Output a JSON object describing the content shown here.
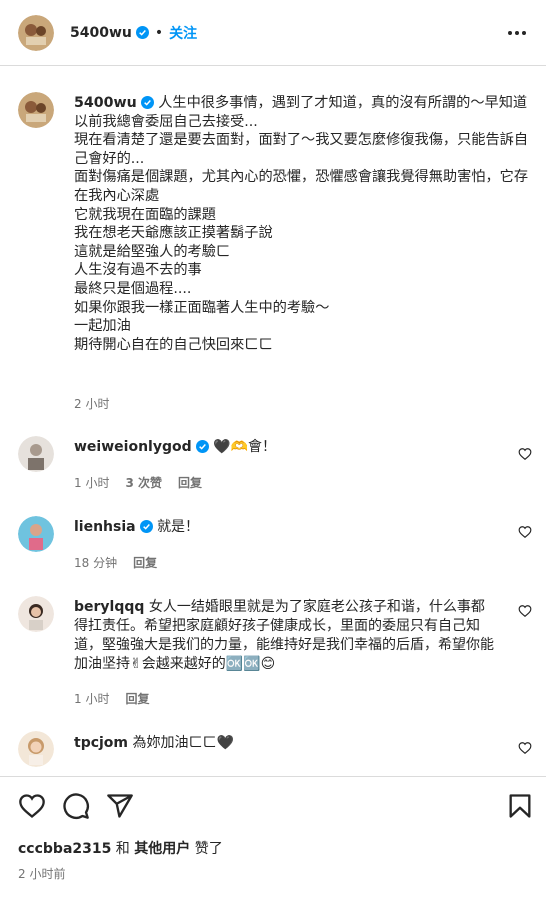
{
  "header": {
    "username": "5400wu",
    "dot": "•",
    "follow_label": "关注"
  },
  "caption": {
    "username": "5400wu",
    "text": "人生中很多事情，遇到了才知道，真的沒有所謂的～早知道\n以前我總會委屈自己去接受...\n現在看清楚了還是要去面對，面對了～我又要怎麼修復我傷，只能告訴自己會好的...\n面對傷痛是個課題，尤其內心的恐懼，恐懼感會讓我覺得無助害怕，它存在我內心深處\n它就我現在面臨的課題\n我在想老天爺應該正摸著鬍子說\n這就是給堅強人的考驗ㄈ\n人生沒有過不去的事\n最終只是個過程....\n如果你跟我一樣正面臨著人生中的考驗～\n一起加油\n期待開心自在的自己快回來ㄈㄈ",
    "time": "2 小时"
  },
  "comments": [
    {
      "username": "weiweionlygod",
      "text": "🖤🫶會！",
      "time": "1 小时",
      "likes": "3 次赞",
      "reply_label": "回复"
    },
    {
      "username": "lienhsia",
      "text": "就是！",
      "time": "18 分钟",
      "reply_label": "回复"
    },
    {
      "username": "berylqqq",
      "text": "女人一结婚眼里就是为了家庭老公孩子和谐，什么事都得扛责任。希望把家庭顧好孩子健康成长，里面的委屈只有自己知道，堅強強大是我们的力量，能维持好是我们幸福的后盾，希望你能加油坚持✌会越来越好的🆗🆗😊",
      "time": "1 小时",
      "reply_label": "回复"
    },
    {
      "username": "tpcjom",
      "text": "為妳加油ㄈㄈ🖤"
    }
  ],
  "likes": {
    "user": "cccbba2315",
    "and": " 和 ",
    "others": "其他用户",
    "suffix": " 赞了"
  },
  "post_time": "2 小时前",
  "colors": {
    "verified": "#0095f6",
    "follow": "#0095f6",
    "meta_gray": "#737373",
    "border": "#dbdbdb"
  },
  "icons": [
    "more-options-icon",
    "verified-badge-icon",
    "heart-icon",
    "comment-icon",
    "share-icon",
    "bookmark-icon"
  ]
}
